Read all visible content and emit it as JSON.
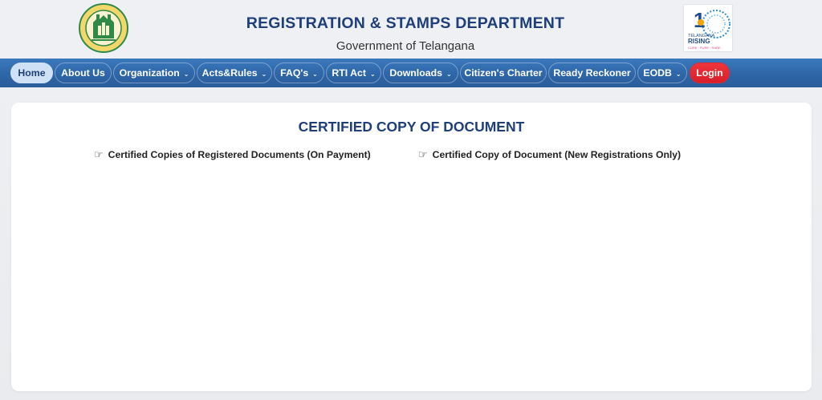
{
  "header": {
    "title": "REGISTRATION & STAMPS DEPARTMENT",
    "subtitle": "Government of Telangana",
    "emblem_text": "GOVERNMENT OF TELANGANA",
    "rising_logo": {
      "number": "1",
      "line1": "TELANGANA",
      "line2": "RISING",
      "tagline": "CURE · PURE · RARE"
    }
  },
  "nav": {
    "items": [
      {
        "label": "Home",
        "active": true
      },
      {
        "label": "About Us"
      },
      {
        "label": "Organization",
        "dropdown": true
      },
      {
        "label": "Acts&Rules",
        "dropdown": true
      },
      {
        "label": "FAQ's",
        "dropdown": true
      },
      {
        "label": "RTI Act",
        "dropdown": true
      },
      {
        "label": "Downloads",
        "dropdown": true
      },
      {
        "label": "Citizen's Charter"
      },
      {
        "label": "Ready Reckoner"
      },
      {
        "label": "EODB",
        "dropdown": true
      },
      {
        "label": "Login",
        "style": "login"
      }
    ],
    "caret": "⌄"
  },
  "main": {
    "title": "CERTIFIED COPY OF DOCUMENT",
    "links": [
      {
        "label": "Certified Copies of Registered Documents (On Payment)",
        "icon": "pointing-hand-icon"
      },
      {
        "label": "Certified Copy of Document (New Registrations Only)",
        "icon": "pointing-hand-icon"
      }
    ]
  },
  "colors": {
    "brand_blue": "#1e3f79",
    "nav_blue": "#2e66a8",
    "active_pill": "#cfe1f4",
    "login_red": "#e02a32"
  }
}
